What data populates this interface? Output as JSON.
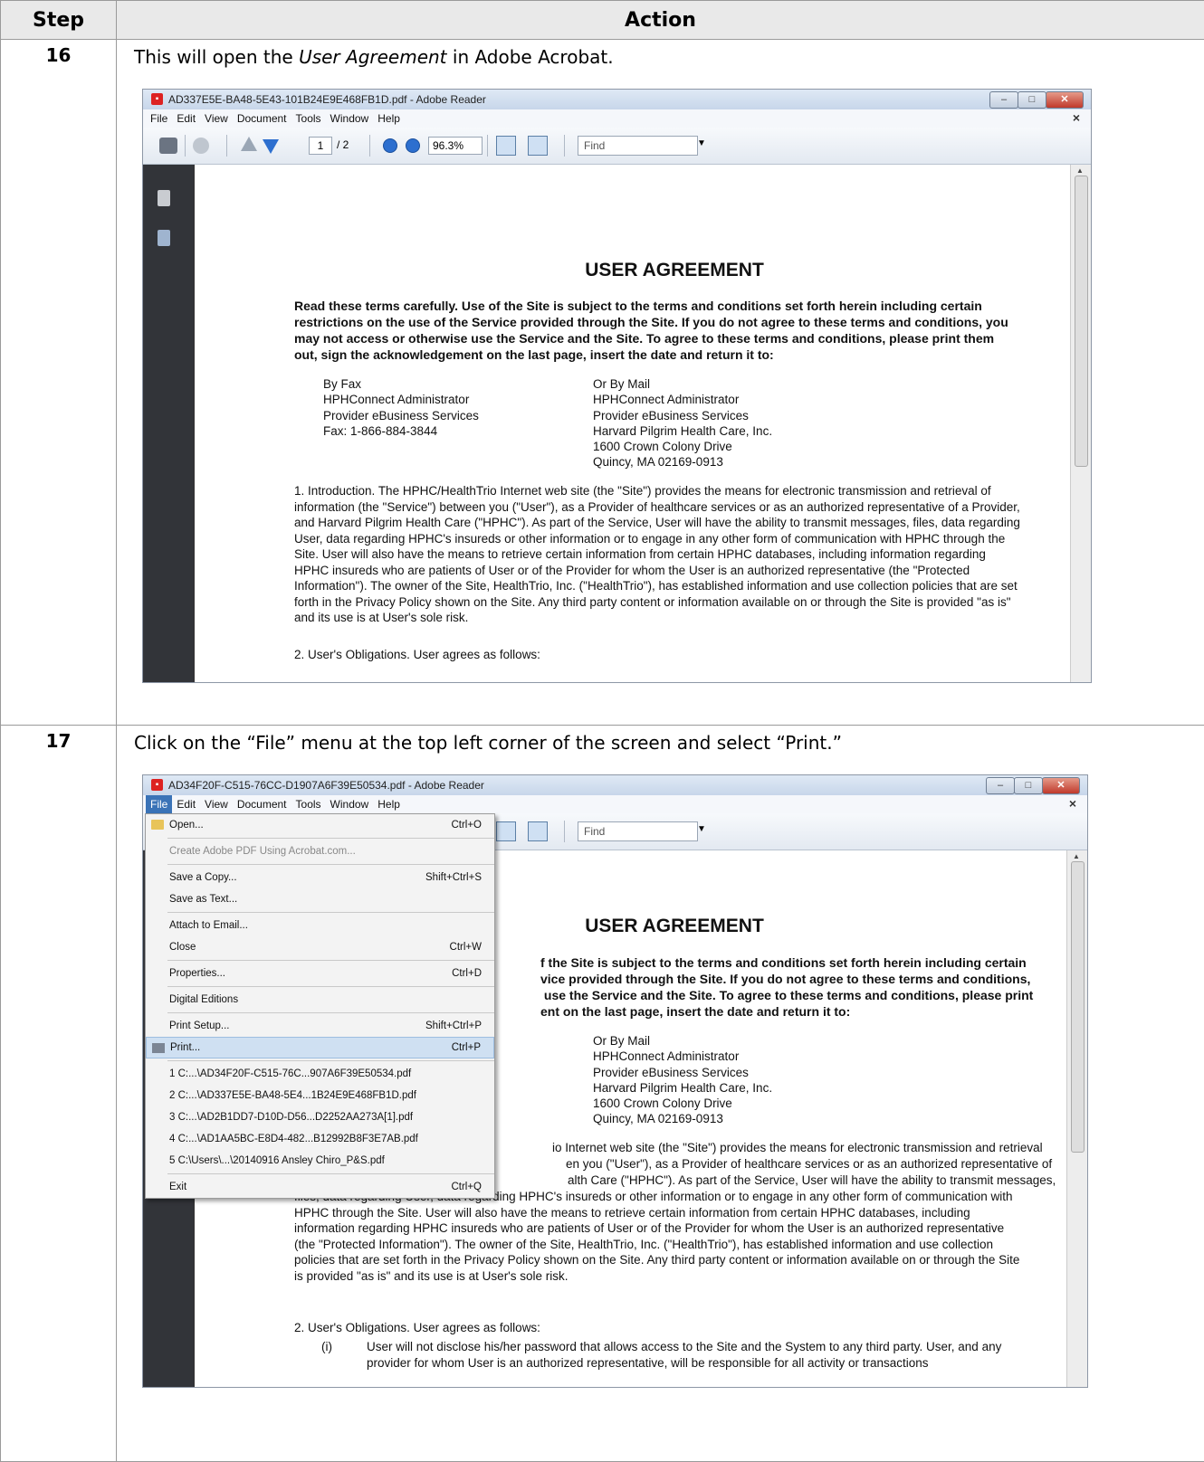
{
  "table": {
    "header_step": "Step",
    "header_action": "Action"
  },
  "step16": {
    "number": "16",
    "text_before": "This will open the ",
    "text_em": "User Agreement",
    "text_after": " in Adobe Acrobat."
  },
  "step17": {
    "number": "17",
    "text": "Click on the “File” menu at the top left corner of the screen and select “Print.”"
  },
  "window1": {
    "title": "AD337E5E-BA48-5E43-101B24E9E468FB1D.pdf - Adobe Reader"
  },
  "window2": {
    "title": "AD34F20F-C515-76CC-D1907A6F39E50534.pdf - Adobe Reader"
  },
  "menu": [
    "File",
    "Edit",
    "View",
    "Document",
    "Tools",
    "Window",
    "Help"
  ],
  "window_close_x": "×",
  "toolbar": {
    "page_current": "1",
    "page_total": "/ 2",
    "zoom": "96.3%",
    "find_placeholder": "Find"
  },
  "doc": {
    "title": "USER AGREEMENT",
    "intro": "Read these terms carefully. Use of the Site is subject to the terms and conditions set forth herein including certain restrictions on the use of the Service provided through the Site. If you do not agree to these terms and conditions, you may not access or otherwise use the Service and the Site. To agree to these terms and conditions, please print them out, sign the acknowledgement on the last page, insert the date and return it to:",
    "intro_visible": "f the Site is subject to the terms and conditions set forth herein including certain\nvice provided through the Site. If you do not agree to these terms and conditions,\n use the Service and the Site. To agree to these terms and conditions, please print\nent on the last page, insert the date and return it to:",
    "fax_lines": "By Fax\nHPHConnect Administrator\nProvider eBusiness Services\nFax: 1-866-884-3844",
    "mail_lines": "Or By Mail\nHPHConnect Administrator\nProvider eBusiness Services\nHarvard Pilgrim Health Care, Inc.\n1600 Crown Colony Drive\nQuincy, MA 02169-0913",
    "intro_section": "1. Introduction. The HPHC/HealthTrio Internet web site (the \"Site\") provides the means for electronic transmission and retrieval of information (the \"Service\") between you (\"User\"), as a Provider of healthcare services or as an authorized representative of a Provider, and Harvard Pilgrim Health Care (\"HPHC\"). As part of the Service, User will have the ability to transmit messages, files, data regarding User, data regarding HPHC's insureds or other information or to engage in any other form of communication with HPHC through the Site. User will also have the means to retrieve certain information from certain HPHC databases, including information regarding HPHC insureds who are patients of User or of the Provider for whom the User is an authorized representative (the \"Protected Information\"). The owner of the Site, HealthTrio, Inc. (\"HealthTrio\"), has established information and use collection policies that are set forth in the Privacy Policy shown on the Site. Any third party content or information available on or through the Site is provided \"as is\" and its use is at User's sole risk.",
    "intro_section_visible_l1": "io Internet web site (the \"Site\") provides the means for electronic transmission and retrieval",
    "intro_section_visible_l2": "en you (\"User\"), as a Provider of healthcare services or as an authorized representative of",
    "intro_section_visible_l3": "alth Care (\"HPHC\"). As part of the Service, User will have the ability to transmit messages,",
    "intro_section_rest": "files, data regarding User, data regarding HPHC's insureds or other information or to engage in any other form of communication with HPHC through the Site. User will also have the means to retrieve certain information from certain HPHC databases, including information regarding HPHC insureds who are patients of User or of the Provider for whom the User is an authorized representative (the \"Protected Information\"). The owner of the Site, HealthTrio, Inc. (\"HealthTrio\"), has established information and use collection policies that are set forth in the Privacy Policy shown on the Site. Any third party content or information available on or through the Site is provided \"as is\" and its use is at User's sole risk.",
    "obligations": "2. User's Obligations. User agrees as follows:",
    "obligation_1_num": "(i)",
    "obligation_1_text": "User will not disclose his/her password that allows access to the Site and the System to any third party. User, and any provider for whom User is an authorized representative, will be responsible for all activity or transactions"
  },
  "file_menu": {
    "items": [
      {
        "label": "Open...",
        "shortcut": "Ctrl+O"
      },
      {
        "label": "Create Adobe PDF Using Acrobat.com...",
        "shortcut": ""
      },
      {
        "label": "Save a Copy...",
        "shortcut": "Shift+Ctrl+S"
      },
      {
        "label": "Save as Text...",
        "shortcut": ""
      },
      {
        "label": "Attach to Email...",
        "shortcut": ""
      },
      {
        "label": "Close",
        "shortcut": "Ctrl+W"
      },
      {
        "label": "Properties...",
        "shortcut": "Ctrl+D"
      },
      {
        "label": "Digital Editions",
        "shortcut": ""
      },
      {
        "label": "Print Setup...",
        "shortcut": "Shift+Ctrl+P"
      },
      {
        "label": "Print...",
        "shortcut": "Ctrl+P"
      },
      {
        "label": "1 C:...\\AD34F20F-C515-76C...907A6F39E50534.pdf",
        "shortcut": ""
      },
      {
        "label": "2 C:...\\AD337E5E-BA48-5E4...1B24E9E468FB1D.pdf",
        "shortcut": ""
      },
      {
        "label": "3 C:...\\AD2B1DD7-D10D-D56...D2252AA273A[1].pdf",
        "shortcut": ""
      },
      {
        "label": "4 C:...\\AD1AA5BC-E8D4-482...B12992B8F3E7AB.pdf",
        "shortcut": ""
      },
      {
        "label": "5 C:\\Users\\...\\20140916 Ansley Chiro_P&S.pdf",
        "shortcut": ""
      },
      {
        "label": "Exit",
        "shortcut": "Ctrl+Q"
      }
    ]
  }
}
